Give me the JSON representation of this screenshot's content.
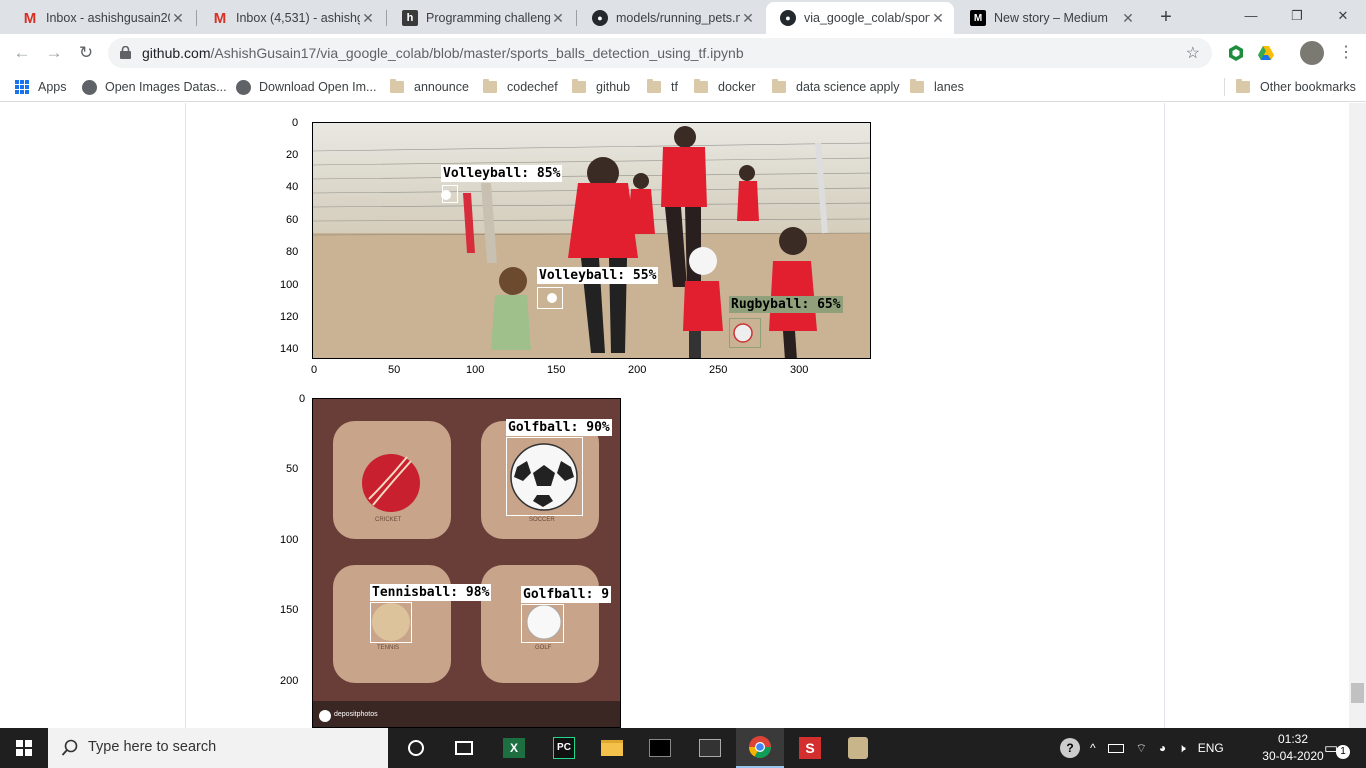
{
  "tabs": [
    {
      "title": "Inbox - ashishgusain20",
      "icon": "gmail-icon"
    },
    {
      "title": "Inbox (4,531) - ashishgu",
      "icon": "gmail-icon"
    },
    {
      "title": "Programming challenge",
      "icon": "hackerrank-icon"
    },
    {
      "title": "models/running_pets.m",
      "icon": "github-icon"
    },
    {
      "title": "via_google_colab/sport",
      "icon": "github-icon",
      "active": true
    },
    {
      "title": "New story – Medium",
      "icon": "medium-icon"
    }
  ],
  "window_controls": {
    "minimize": "—",
    "restore": "❐",
    "close": "✕"
  },
  "omnibox": {
    "domain": "github.com",
    "path": "/AshishGusain17/via_google_colab/blob/master/sports_balls_detection_using_tf.ipynb"
  },
  "bookmarks": [
    {
      "label": "Apps",
      "icon": "apps-grid-icon"
    },
    {
      "label": "Open Images Datas...",
      "icon": "open-images-icon"
    },
    {
      "label": "Download Open Im...",
      "icon": "open-images-icon"
    },
    {
      "label": "announce",
      "icon": "folder-icon"
    },
    {
      "label": "codechef",
      "icon": "folder-icon"
    },
    {
      "label": "github",
      "icon": "folder-icon"
    },
    {
      "label": "tf",
      "icon": "folder-icon"
    },
    {
      "label": "docker",
      "icon": "folder-icon"
    },
    {
      "label": "data science apply",
      "icon": "folder-icon"
    },
    {
      "label": "lanes",
      "icon": "folder-icon"
    }
  ],
  "other_bookmarks": "Other bookmarks",
  "plot1": {
    "y_ticks": [
      "0",
      "20",
      "40",
      "60",
      "80",
      "100",
      "120",
      "140"
    ],
    "x_ticks": [
      "0",
      "50",
      "100",
      "150",
      "200",
      "250",
      "300"
    ],
    "detections": [
      {
        "label": "Volleyball: 85%",
        "color": "#ffffff"
      },
      {
        "label": "Volleyball: 55%",
        "color": "#ffffff"
      },
      {
        "label": "Rugbyball: 65%",
        "color": "#8fa07a"
      }
    ]
  },
  "plot2": {
    "y_ticks": [
      "0",
      "50",
      "100",
      "150",
      "200"
    ],
    "tile_labels": [
      "CRICKET",
      "SOCCER",
      "TENNIS",
      "GOLF"
    ],
    "watermark": "depositphotos",
    "detections": [
      {
        "label": "Golfball: 90%",
        "color": "#ffffff"
      },
      {
        "label": "Tennisball: 98%",
        "color": "#ffffff"
      },
      {
        "label": "Golfball: 9",
        "color": "#ffffff"
      }
    ]
  },
  "taskbar": {
    "search_placeholder": "Type here to search",
    "language": "ENG",
    "time": "01:32",
    "date": "30-04-2020",
    "notification_count": "1"
  }
}
